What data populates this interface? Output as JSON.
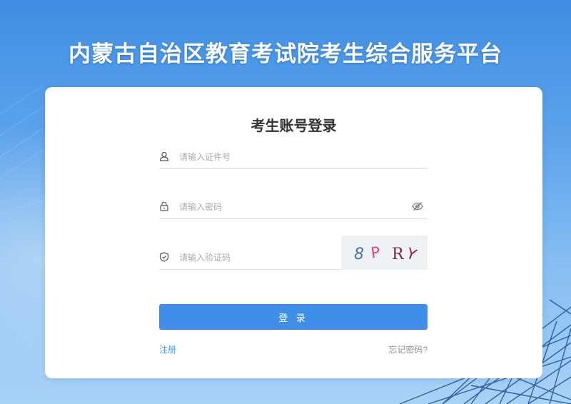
{
  "page": {
    "title": "内蒙古自治区教育考试院考生综合服务平台"
  },
  "login_card": {
    "title": "考生账号登录",
    "id_field": {
      "placeholder": "请输入证件号",
      "value": "",
      "icon": "user-icon"
    },
    "password_field": {
      "placeholder": "请输入密码",
      "value": "",
      "icon": "lock-icon",
      "toggle_icon": "eye-off-icon"
    },
    "captcha_field": {
      "placeholder": "请输入验证码",
      "value": "",
      "icon": "shield-check-icon"
    },
    "captcha_image": {
      "text": "8 P R Y"
    },
    "login_button": "登 录",
    "register_link": "注册",
    "forgot_link": "忘记密码?"
  },
  "colors": {
    "primary": "#3f8fe9",
    "link": "#409eff",
    "background_top": "#3f8de3",
    "background_bottom": "#a9d2f7"
  }
}
